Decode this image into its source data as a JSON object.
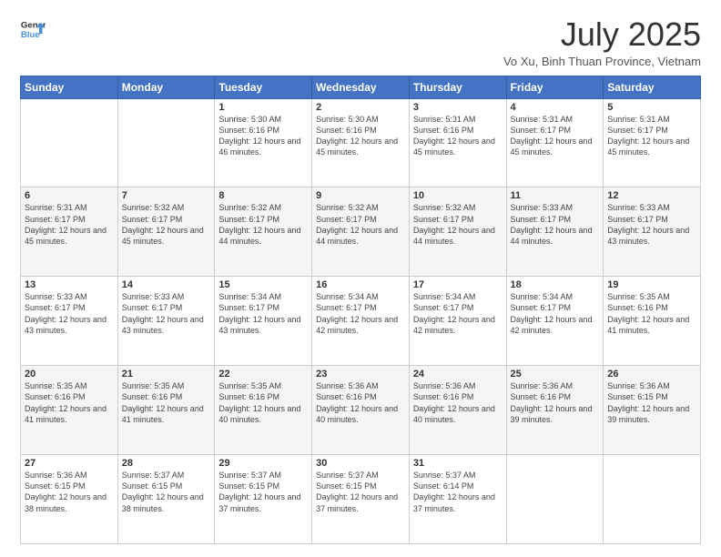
{
  "logo": {
    "line1": "General",
    "line2": "Blue"
  },
  "title": {
    "month_year": "July 2025",
    "location": "Vo Xu, Binh Thuan Province, Vietnam"
  },
  "weekdays": [
    "Sunday",
    "Monday",
    "Tuesday",
    "Wednesday",
    "Thursday",
    "Friday",
    "Saturday"
  ],
  "weeks": [
    [
      {
        "day": "",
        "info": ""
      },
      {
        "day": "",
        "info": ""
      },
      {
        "day": "1",
        "info": "Sunrise: 5:30 AM\nSunset: 6:16 PM\nDaylight: 12 hours and 46 minutes."
      },
      {
        "day": "2",
        "info": "Sunrise: 5:30 AM\nSunset: 6:16 PM\nDaylight: 12 hours and 45 minutes."
      },
      {
        "day": "3",
        "info": "Sunrise: 5:31 AM\nSunset: 6:16 PM\nDaylight: 12 hours and 45 minutes."
      },
      {
        "day": "4",
        "info": "Sunrise: 5:31 AM\nSunset: 6:17 PM\nDaylight: 12 hours and 45 minutes."
      },
      {
        "day": "5",
        "info": "Sunrise: 5:31 AM\nSunset: 6:17 PM\nDaylight: 12 hours and 45 minutes."
      }
    ],
    [
      {
        "day": "6",
        "info": "Sunrise: 5:31 AM\nSunset: 6:17 PM\nDaylight: 12 hours and 45 minutes."
      },
      {
        "day": "7",
        "info": "Sunrise: 5:32 AM\nSunset: 6:17 PM\nDaylight: 12 hours and 45 minutes."
      },
      {
        "day": "8",
        "info": "Sunrise: 5:32 AM\nSunset: 6:17 PM\nDaylight: 12 hours and 44 minutes."
      },
      {
        "day": "9",
        "info": "Sunrise: 5:32 AM\nSunset: 6:17 PM\nDaylight: 12 hours and 44 minutes."
      },
      {
        "day": "10",
        "info": "Sunrise: 5:32 AM\nSunset: 6:17 PM\nDaylight: 12 hours and 44 minutes."
      },
      {
        "day": "11",
        "info": "Sunrise: 5:33 AM\nSunset: 6:17 PM\nDaylight: 12 hours and 44 minutes."
      },
      {
        "day": "12",
        "info": "Sunrise: 5:33 AM\nSunset: 6:17 PM\nDaylight: 12 hours and 43 minutes."
      }
    ],
    [
      {
        "day": "13",
        "info": "Sunrise: 5:33 AM\nSunset: 6:17 PM\nDaylight: 12 hours and 43 minutes."
      },
      {
        "day": "14",
        "info": "Sunrise: 5:33 AM\nSunset: 6:17 PM\nDaylight: 12 hours and 43 minutes."
      },
      {
        "day": "15",
        "info": "Sunrise: 5:34 AM\nSunset: 6:17 PM\nDaylight: 12 hours and 43 minutes."
      },
      {
        "day": "16",
        "info": "Sunrise: 5:34 AM\nSunset: 6:17 PM\nDaylight: 12 hours and 42 minutes."
      },
      {
        "day": "17",
        "info": "Sunrise: 5:34 AM\nSunset: 6:17 PM\nDaylight: 12 hours and 42 minutes."
      },
      {
        "day": "18",
        "info": "Sunrise: 5:34 AM\nSunset: 6:17 PM\nDaylight: 12 hours and 42 minutes."
      },
      {
        "day": "19",
        "info": "Sunrise: 5:35 AM\nSunset: 6:16 PM\nDaylight: 12 hours and 41 minutes."
      }
    ],
    [
      {
        "day": "20",
        "info": "Sunrise: 5:35 AM\nSunset: 6:16 PM\nDaylight: 12 hours and 41 minutes."
      },
      {
        "day": "21",
        "info": "Sunrise: 5:35 AM\nSunset: 6:16 PM\nDaylight: 12 hours and 41 minutes."
      },
      {
        "day": "22",
        "info": "Sunrise: 5:35 AM\nSunset: 6:16 PM\nDaylight: 12 hours and 40 minutes."
      },
      {
        "day": "23",
        "info": "Sunrise: 5:36 AM\nSunset: 6:16 PM\nDaylight: 12 hours and 40 minutes."
      },
      {
        "day": "24",
        "info": "Sunrise: 5:36 AM\nSunset: 6:16 PM\nDaylight: 12 hours and 40 minutes."
      },
      {
        "day": "25",
        "info": "Sunrise: 5:36 AM\nSunset: 6:16 PM\nDaylight: 12 hours and 39 minutes."
      },
      {
        "day": "26",
        "info": "Sunrise: 5:36 AM\nSunset: 6:15 PM\nDaylight: 12 hours and 39 minutes."
      }
    ],
    [
      {
        "day": "27",
        "info": "Sunrise: 5:36 AM\nSunset: 6:15 PM\nDaylight: 12 hours and 38 minutes."
      },
      {
        "day": "28",
        "info": "Sunrise: 5:37 AM\nSunset: 6:15 PM\nDaylight: 12 hours and 38 minutes."
      },
      {
        "day": "29",
        "info": "Sunrise: 5:37 AM\nSunset: 6:15 PM\nDaylight: 12 hours and 37 minutes."
      },
      {
        "day": "30",
        "info": "Sunrise: 5:37 AM\nSunset: 6:15 PM\nDaylight: 12 hours and 37 minutes."
      },
      {
        "day": "31",
        "info": "Sunrise: 5:37 AM\nSunset: 6:14 PM\nDaylight: 12 hours and 37 minutes."
      },
      {
        "day": "",
        "info": ""
      },
      {
        "day": "",
        "info": ""
      }
    ]
  ]
}
